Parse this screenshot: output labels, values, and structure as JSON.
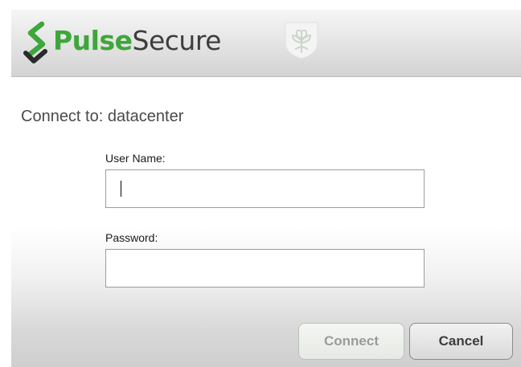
{
  "header": {
    "brand_pulse": "Pulse",
    "brand_secure": "Secure",
    "brand_color": "#3ea63a",
    "logo_icon": "pulse-secure-logo-icon",
    "site_logo_icon": "leaf-shield-icon"
  },
  "main": {
    "connect_to": "Connect to: datacenter",
    "username_label": "User Name:",
    "username_value": "",
    "password_label": "Password:",
    "password_value": ""
  },
  "buttons": {
    "connect_label": "Connect",
    "cancel_label": "Cancel"
  }
}
